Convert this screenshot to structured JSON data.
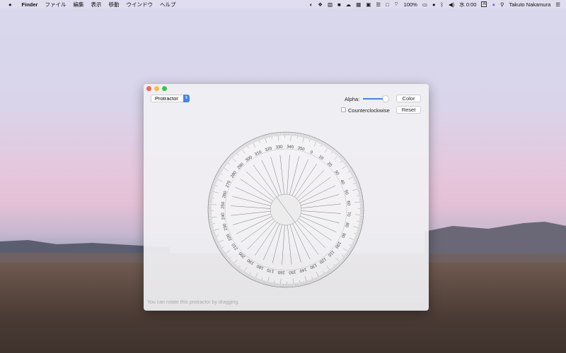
{
  "menubar": {
    "apple": "",
    "app": "Finder",
    "items": [
      "ファイル",
      "編集",
      "表示",
      "移動",
      "ウインドウ",
      "ヘルプ"
    ],
    "battery": "100%",
    "clock": "水 0:00",
    "input": "A",
    "user": "Takuto Nakamura"
  },
  "window": {
    "mode_select": "Protractor",
    "alpha_label": "Alpha:",
    "alpha_value": 0.9,
    "color_button": "Color",
    "counterclockwise_label": "Counterclockwise",
    "counterclockwise_checked": false,
    "reset_button": "Reset",
    "footer": "You can rotate this protractor by dragging."
  },
  "protractor": {
    "labels": [
      "0",
      "10",
      "20",
      "30",
      "40",
      "50",
      "60",
      "70",
      "80",
      "90",
      "100",
      "110",
      "120",
      "130",
      "140",
      "150",
      "160",
      "170",
      "180",
      "190",
      "200",
      "210",
      "220",
      "230",
      "240",
      "250",
      "260",
      "270",
      "280",
      "290",
      "300",
      "310",
      "320",
      "330",
      "340",
      "350"
    ],
    "rotation_deg": 24,
    "line_color": "#777777"
  }
}
